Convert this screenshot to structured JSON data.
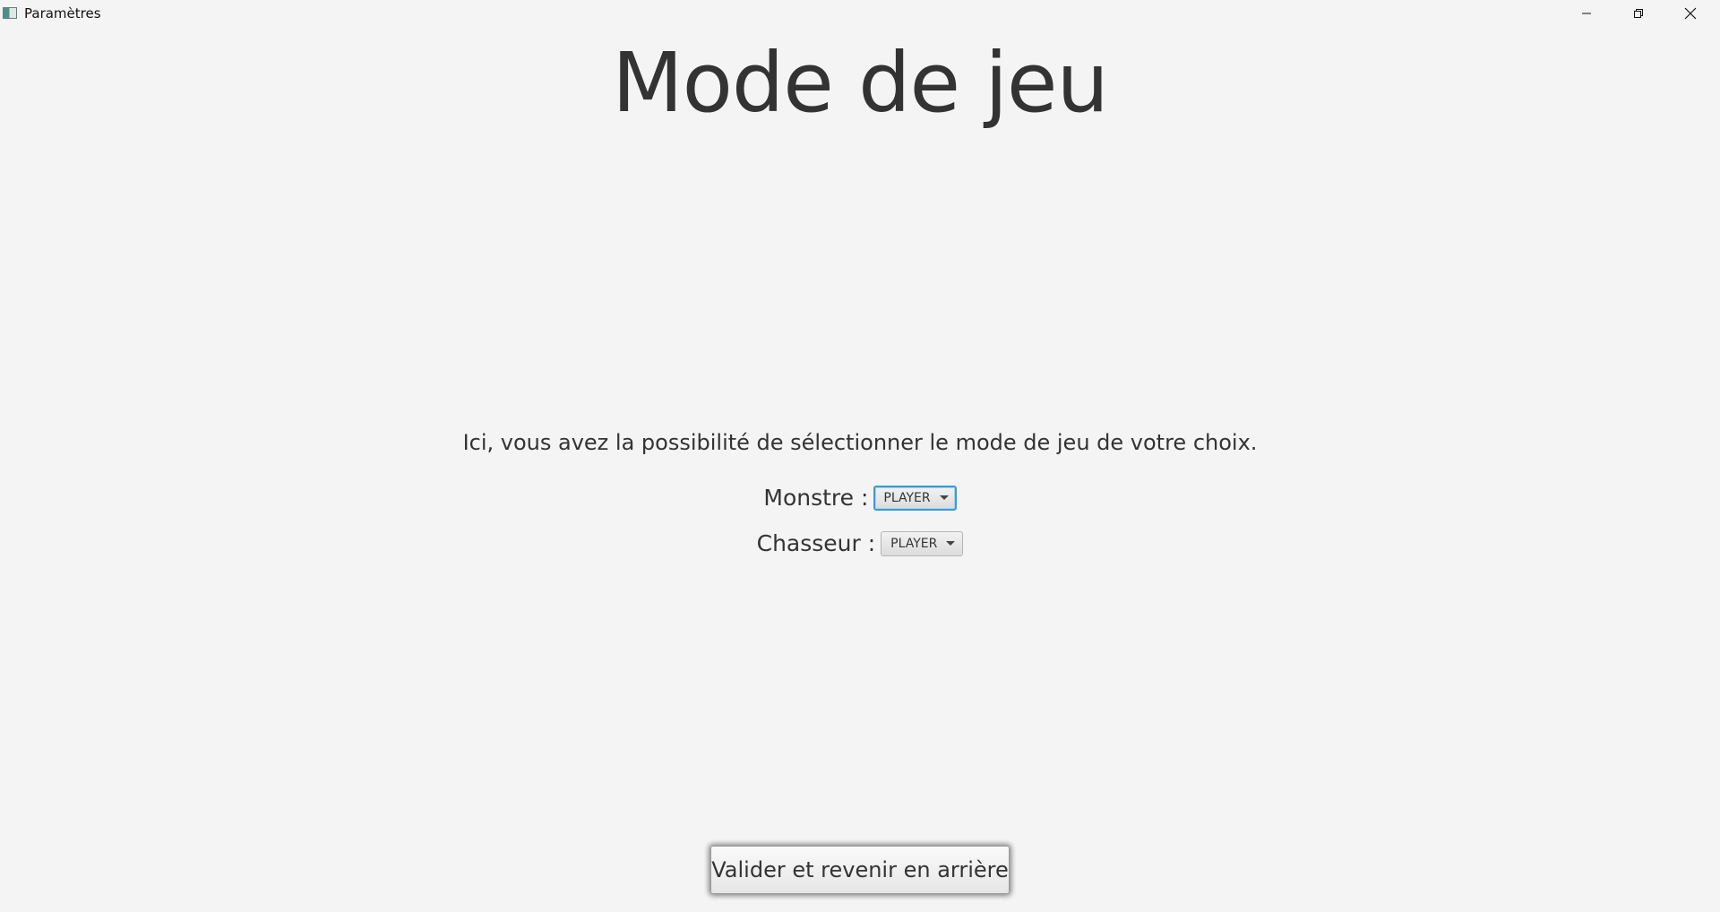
{
  "window": {
    "title": "Paramètres",
    "controls": {
      "minimize": "minimize-icon",
      "maximize": "restore-icon",
      "close": "close-icon"
    }
  },
  "main": {
    "heading": "Mode de jeu",
    "description": "Ici, vous avez la possibilité de sélectionner le mode de jeu de votre choix.",
    "monstre": {
      "label": "Monstre :",
      "selected": "PLAYER"
    },
    "chasseur": {
      "label": "Chasseur :",
      "selected": "PLAYER"
    },
    "validate_button": "Valider et revenir en arrière"
  },
  "colors": {
    "background": "#f4f4f4",
    "text": "#333333",
    "focus_border": "#3d9ad4"
  }
}
